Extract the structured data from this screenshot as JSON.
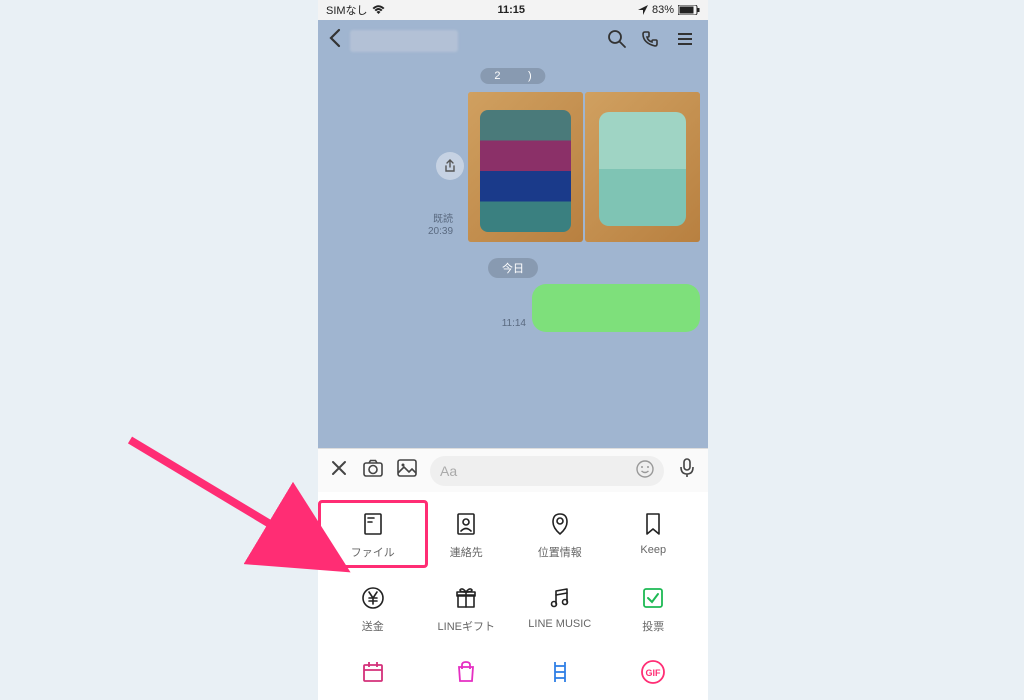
{
  "statusbar": {
    "carrier": "SIMなし",
    "time": "11:15",
    "battery_pct": "83%"
  },
  "header": {
    "title_blurred": true
  },
  "chat": {
    "date1": "2",
    "read_label": "既読",
    "read_time": "20:39",
    "date2": "今日",
    "bubble_time": "11:14"
  },
  "input": {
    "placeholder": "Aa"
  },
  "attachments": [
    {
      "label": "ファイル",
      "icon": "file"
    },
    {
      "label": "連絡先",
      "icon": "contact"
    },
    {
      "label": "位置情報",
      "icon": "location"
    },
    {
      "label": "Keep",
      "icon": "bookmark"
    },
    {
      "label": "送金",
      "icon": "yen"
    },
    {
      "label": "LINEギフト",
      "icon": "gift"
    },
    {
      "label": "LINE MUSIC",
      "icon": "music"
    },
    {
      "label": "投票",
      "icon": "vote"
    },
    {
      "label": "",
      "icon": "calendar"
    },
    {
      "label": "",
      "icon": "shopping"
    },
    {
      "label": "",
      "icon": "ladder"
    },
    {
      "label": "",
      "icon": "gif"
    }
  ],
  "annotation": {
    "highlight_index": 0
  }
}
